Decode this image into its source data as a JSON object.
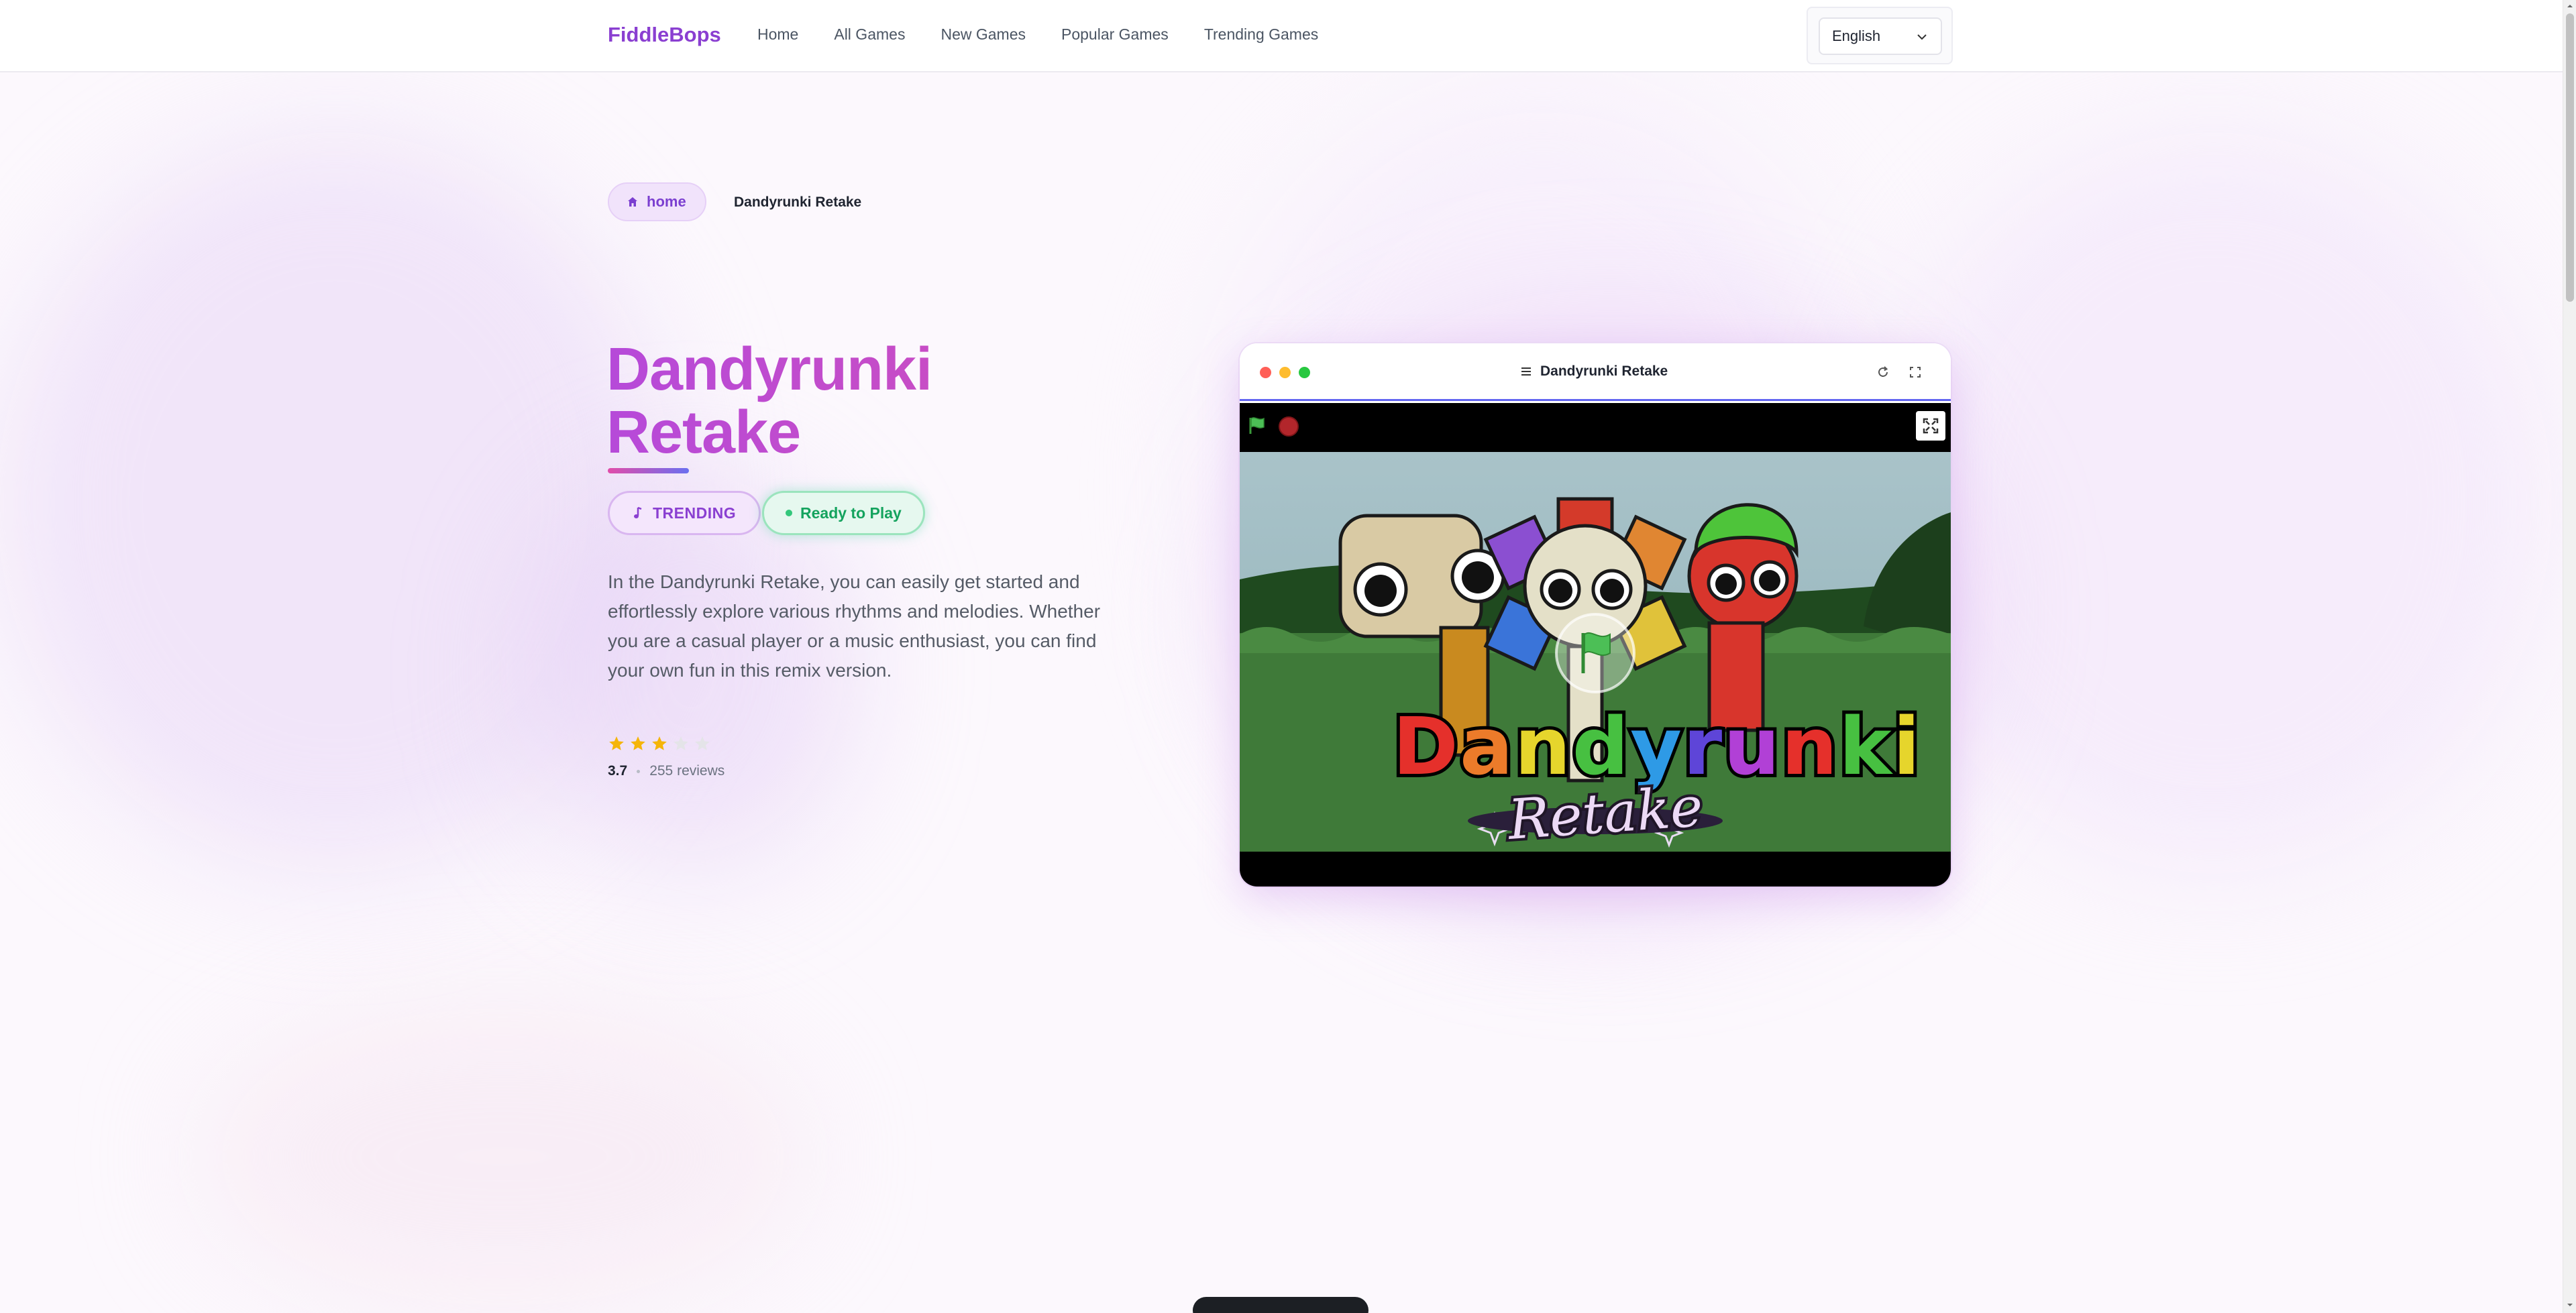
{
  "header": {
    "logo": "FiddleBops",
    "nav": [
      "Home",
      "All Games",
      "New Games",
      "Popular Games",
      "Trending Games"
    ],
    "language": "English"
  },
  "breadcrumb": {
    "home": "home",
    "current": "Dandyrunki Retake"
  },
  "hero": {
    "title_line1": "Dandyrunki",
    "title_line2": "Retake",
    "badge_trending": "TRENDING",
    "badge_ready": "Ready to Play",
    "description": "In the Dandyrunki Retake, you can easily get started and effortlessly explore various rhythms and melodies. Whether you are a casual player or a music enthusiast, you can find your own fun in this remix version.",
    "rating": {
      "value": "3.7",
      "stars_filled": 3,
      "stars_total": 5,
      "reviews": "255 reviews"
    }
  },
  "game_window": {
    "title": "Dandyrunki Retake",
    "scene_title": "Dandyrunki",
    "scene_subtitle": "Retake"
  },
  "colors": {
    "brand": "#8a3fd1",
    "title_gradient_start": "#b64ad9",
    "title_gradient_end": "#d64fb5",
    "ready_green": "#14a35e",
    "star_gold": "#f5b50a",
    "accent_bar": "#6366f1"
  },
  "icons": [
    "home-icon",
    "music-note-icon",
    "menu-icon",
    "reload-icon",
    "fullscreen-icon",
    "green-flag-icon",
    "stop-icon",
    "expand-icon",
    "chevron-down-icon",
    "star-icon"
  ]
}
